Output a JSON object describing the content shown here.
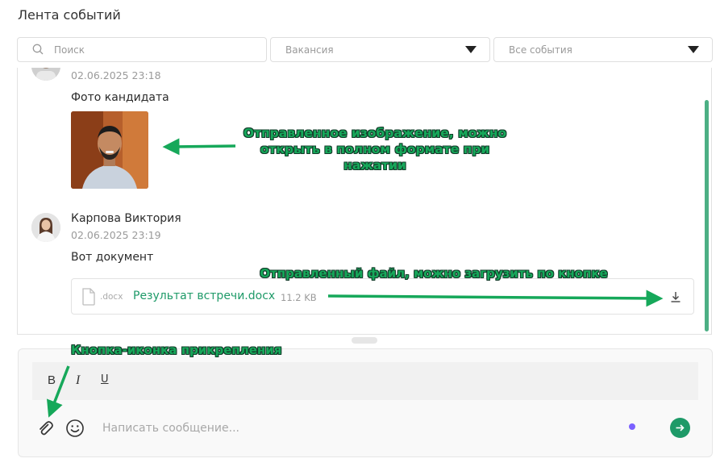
{
  "page": {
    "title": "Лента событий"
  },
  "filters": {
    "search_placeholder": "Поиск",
    "vacancy_placeholder": "Вакансия",
    "events_value": "Все события"
  },
  "feed": {
    "message1": {
      "timestamp": "02.06.2025 23:18",
      "text": "Фото кандидата"
    },
    "message2": {
      "author": "Карпова Виктория",
      "timestamp": "02.06.2025 23:19",
      "text": "Вот документ",
      "file": {
        "ext": ".docx",
        "name": "Результат встречи.docx",
        "size": "11.2 KB"
      }
    }
  },
  "composer": {
    "bold_label": "B",
    "italic_label": "I",
    "underline_label": "U",
    "placeholder": "Написать сообщение..."
  },
  "annotations": {
    "image": "Отправленное изображение, можно открыть в полном формате при нажатии",
    "file": "Отправленный файл, можно загрузить по кнопке",
    "attach": "Кнопка-иконка прикрепления"
  },
  "colors": {
    "accent": "#1e9a68",
    "annotation": "#16a85a",
    "status_dot": "#7b61ff"
  },
  "icons": [
    "search-icon",
    "caret-down-icon",
    "file-icon",
    "download-icon",
    "paperclip-icon",
    "emoji-icon",
    "send-arrow-icon"
  ]
}
